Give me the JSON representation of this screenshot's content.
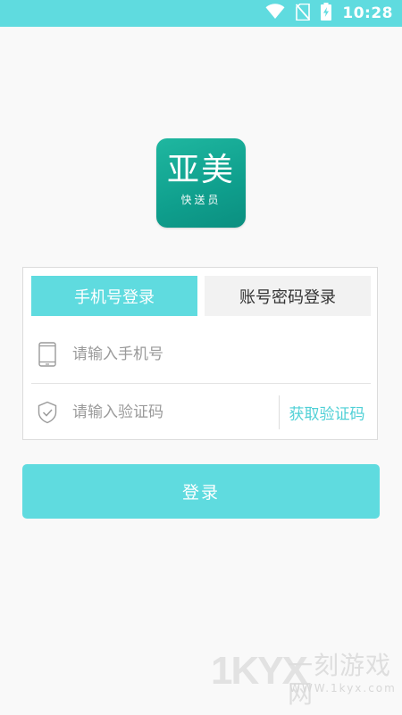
{
  "status_bar": {
    "time": "10:28",
    "icons": [
      "wifi-icon",
      "no-sim-icon",
      "battery-charging-icon"
    ],
    "color": "#5fdbdf"
  },
  "logo": {
    "title": "亚美",
    "subtitle": "快送员",
    "color": "#12a897"
  },
  "login": {
    "tabs": [
      {
        "label": "手机号登录",
        "active": true
      },
      {
        "label": "账号密码登录",
        "active": false
      }
    ],
    "phone_placeholder": "请输入手机号",
    "phone_icon": "phone-icon",
    "code_placeholder": "请输入验证码",
    "code_icon": "shield-check-icon",
    "get_code_label": "获取验证码",
    "submit_label": "登录"
  },
  "colors": {
    "accent": "#5fdbdf",
    "link": "#4fd0d6",
    "background": "#f9f9f9"
  },
  "watermark": {
    "mark": "1KYX",
    "name": "一刻游戏网",
    "url": "WWW.1kyx.com"
  }
}
